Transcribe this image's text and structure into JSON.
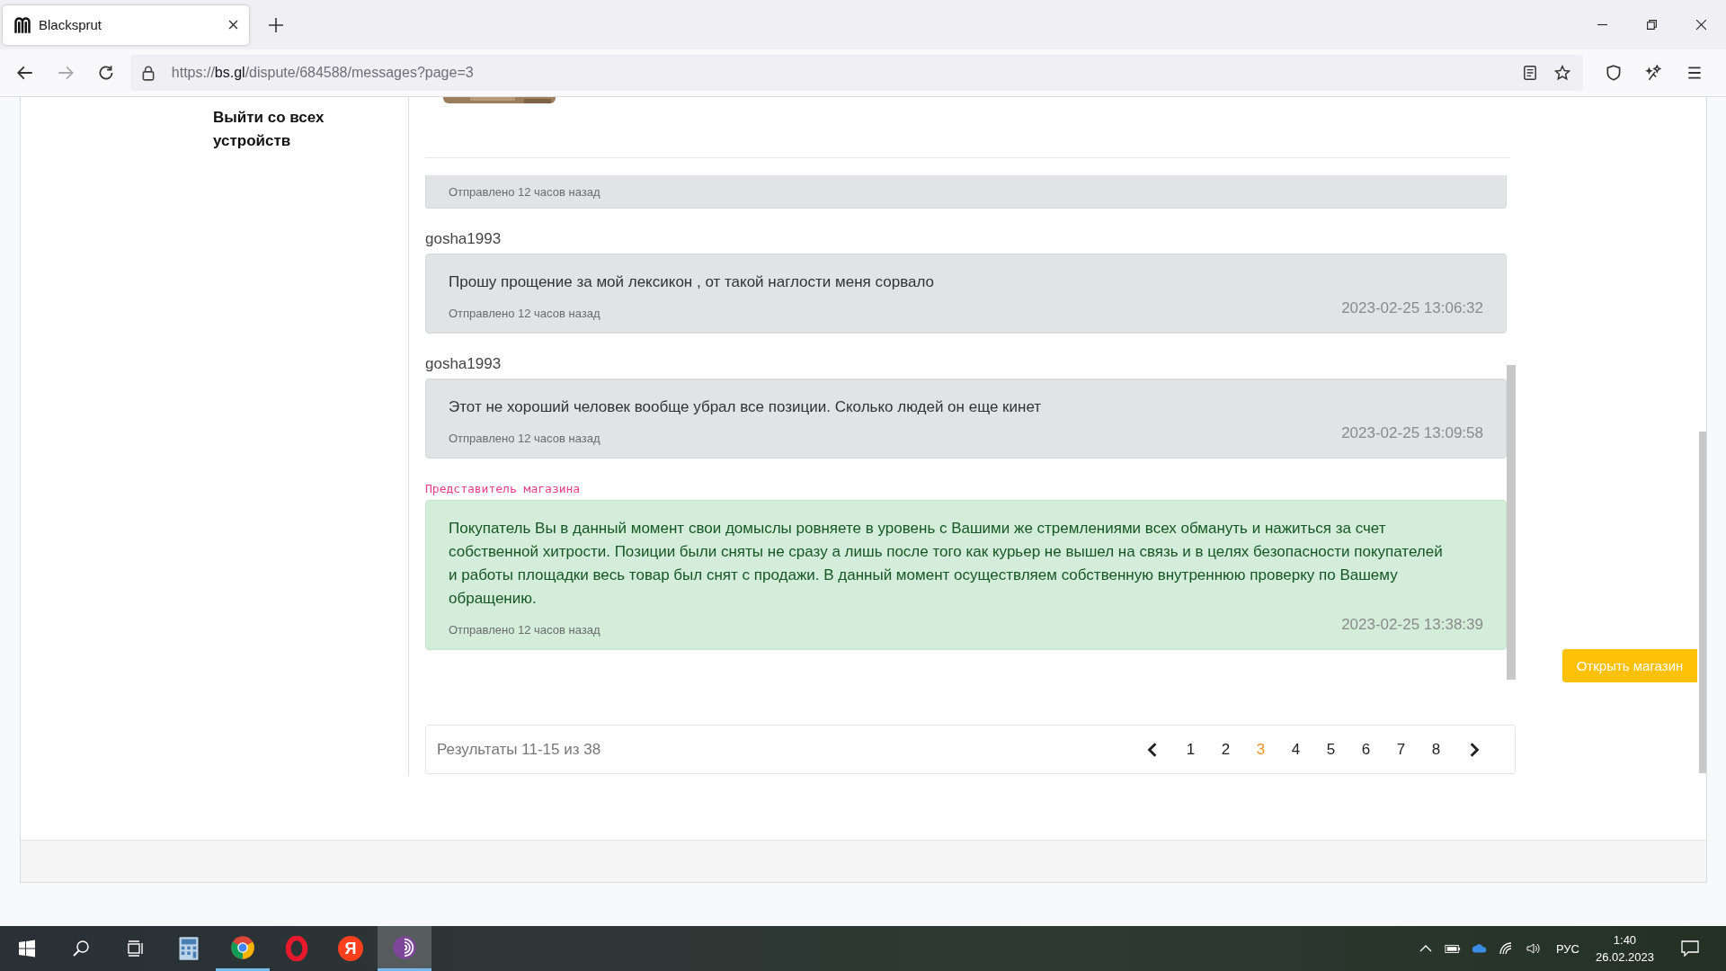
{
  "browser": {
    "tab_title": "Blacksprut",
    "url_scheme": "https://",
    "url_host": "bs.gl",
    "url_path": "/dispute/684588/messages?page=3"
  },
  "sidebar": {
    "logout_link": "Выйти со всех устройств"
  },
  "messages": [
    {
      "kind": "clipped",
      "sent": "Отправлено 12 часов назад"
    },
    {
      "kind": "user",
      "author": "gosha1993",
      "text": "Прошу прощение за мой лексикон , от такой наглости меня сорвало",
      "sent": "Отправлено 12 часов назад",
      "time": "2023-02-25 13:06:32"
    },
    {
      "kind": "user",
      "author": "gosha1993",
      "text": "Этот не хороший человек вообще убрал все позиции. Сколько людей он еще кинет",
      "sent": "Отправлено 12 часов назад",
      "time": "2023-02-25 13:09:58"
    },
    {
      "kind": "shop",
      "author": "Представитель магазина",
      "text": "Покупатель Вы в данный момент свои домыслы ровняете в уровень с Вашими же стремлениями всех обмануть и нажиться за счет собственной хитрости. Позиции были сняты не сразу а лишь после того как курьер не вышел на связь и в целях безопасности покупателей и работы площадки весь товар был снят с продажи. В данный момент осуществляем собственную внутреннюю проверку по Вашему обращению.",
      "sent": "Отправлено 12 часов назад",
      "time": "2023-02-25 13:38:39"
    }
  ],
  "pagination": {
    "summary": "Результаты 11-15 из 38",
    "pages": [
      {
        "label": "1",
        "selected": false
      },
      {
        "label": "2",
        "selected": false
      },
      {
        "label": "3",
        "selected": true
      },
      {
        "label": "4",
        "selected": false
      },
      {
        "label": "5",
        "selected": false
      },
      {
        "label": "6",
        "selected": false
      },
      {
        "label": "7",
        "selected": false
      },
      {
        "label": "8",
        "selected": false
      }
    ]
  },
  "open_shop_button": "Открыть магазин",
  "taskbar": {
    "apps": [
      {
        "kind": "calculator",
        "running": false,
        "active": false
      },
      {
        "kind": "chrome",
        "running": true,
        "active": false
      },
      {
        "kind": "opera",
        "running": false,
        "active": false
      },
      {
        "kind": "yandex",
        "label": "Я",
        "running": false,
        "active": false
      },
      {
        "kind": "tor",
        "running": true,
        "active": true
      }
    ],
    "language": "РУС",
    "time": "1:40",
    "date": "26.02.2023"
  }
}
